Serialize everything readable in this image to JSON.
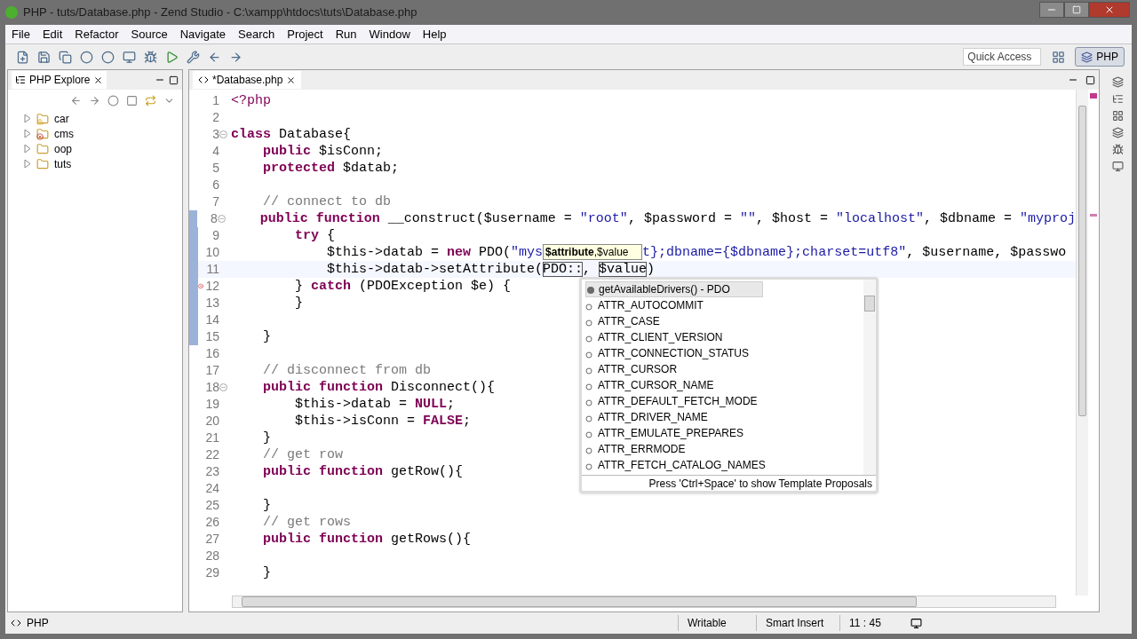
{
  "window": {
    "title": "PHP - tuts/Database.php - Zend Studio - C:\\xampp\\htdocs\\tuts\\Database.php"
  },
  "menu": [
    "File",
    "Edit",
    "Refactor",
    "Source",
    "Navigate",
    "Search",
    "Project",
    "Run",
    "Window",
    "Help"
  ],
  "quick_access": {
    "placeholder": "Quick Access"
  },
  "perspective": {
    "label": "PHP",
    "selected": true
  },
  "explorer": {
    "title": "PHP Explore",
    "items": [
      {
        "name": "car",
        "expanded": false,
        "kind": "warning"
      },
      {
        "name": "cms",
        "expanded": false,
        "kind": "error"
      },
      {
        "name": "oop",
        "expanded": false,
        "kind": "plain"
      },
      {
        "name": "tuts",
        "expanded": false,
        "kind": "plain"
      }
    ]
  },
  "editor": {
    "tab": {
      "label": "*Database.php",
      "selected": true
    },
    "lines": [
      {
        "number": "1",
        "tokens": [
          {
            "kind": "tag",
            "text": "<?php"
          }
        ]
      },
      {
        "number": "2"
      },
      {
        "number": "3",
        "fold": true,
        "tokens": [
          {
            "kind": "keyword",
            "text": "class"
          },
          {
            "kind": "plain",
            "text": " Database{"
          }
        ]
      },
      {
        "number": "4",
        "tokens": [
          {
            "kind": "keyword",
            "text": "    public"
          },
          {
            "kind": "plain",
            "text": " $isConn;"
          }
        ]
      },
      {
        "number": "5",
        "tokens": [
          {
            "kind": "keyword",
            "text": "    protected"
          },
          {
            "kind": "plain",
            "text": " $datab;"
          }
        ]
      },
      {
        "number": "6"
      },
      {
        "number": "7",
        "tokens": [
          {
            "kind": "comment",
            "text": "    // connect to db"
          }
        ]
      },
      {
        "number": "8",
        "fold": true,
        "changed": true,
        "tokens": [
          {
            "kind": "keyword",
            "text": "    public"
          },
          {
            "kind": "keyword",
            "text": " function"
          },
          {
            "kind": "plain",
            "text": " __construct($username = "
          },
          {
            "kind": "string",
            "text": "\"root\""
          },
          {
            "kind": "plain",
            "text": ", $password = "
          },
          {
            "kind": "string",
            "text": "\"\""
          },
          {
            "kind": "plain",
            "text": ", $host = "
          },
          {
            "kind": "string",
            "text": "\"localhost\""
          },
          {
            "kind": "plain",
            "text": ", $dbname = "
          },
          {
            "kind": "string",
            "text": "\"myproj"
          }
        ]
      },
      {
        "number": "9",
        "changed": true,
        "tokens": [
          {
            "kind": "keyword",
            "text": "        try"
          },
          {
            "kind": "plain",
            "text": " {"
          }
        ]
      },
      {
        "number": "10",
        "changed": true,
        "tokens": [
          {
            "kind": "plain",
            "text": "            $this->datab = "
          },
          {
            "kind": "keyword",
            "text": "new"
          },
          {
            "kind": "plain",
            "text": " PDO("
          },
          {
            "kind": "string",
            "text": "\"mys"
          },
          {
            "kind": "hint",
            "text": "**$attribute**,$value"
          },
          {
            "kind": "string",
            "text": "t};dbname={$dbname};charset=utf8\""
          },
          {
            "kind": "plain",
            "text": ", $username, $passwo"
          }
        ]
      },
      {
        "number": "11",
        "changed": true,
        "current": true,
        "tokens": [
          {
            "kind": "plain",
            "text": "            $this->datab->setAttribute("
          },
          {
            "kind": "linked",
            "text": "PDO::"
          },
          {
            "kind": "plain",
            "text": ", "
          },
          {
            "kind": "linked",
            "text": "$value"
          },
          {
            "kind": "plain",
            "text": ")"
          }
        ]
      },
      {
        "number": "12",
        "changed": true,
        "error": true,
        "tokens": [
          {
            "kind": "plain",
            "text": "        } "
          },
          {
            "kind": "keyword",
            "text": "catch"
          },
          {
            "kind": "plain",
            "text": " (PDOException $e) {"
          }
        ]
      },
      {
        "number": "13",
        "changed": true,
        "tokens": [
          {
            "kind": "plain",
            "text": "        }"
          }
        ]
      },
      {
        "number": "14",
        "changed": true
      },
      {
        "number": "15",
        "changed": true,
        "tokens": [
          {
            "kind": "plain",
            "text": "    }"
          }
        ]
      },
      {
        "number": "16"
      },
      {
        "number": "17",
        "tokens": [
          {
            "kind": "comment",
            "text": "    // disconnect from db"
          }
        ]
      },
      {
        "number": "18",
        "fold": true,
        "tokens": [
          {
            "kind": "keyword",
            "text": "    public"
          },
          {
            "kind": "keyword",
            "text": " function"
          },
          {
            "kind": "plain",
            "text": " Disconnect(){"
          }
        ]
      },
      {
        "number": "19",
        "tokens": [
          {
            "kind": "plain",
            "text": "        $this->datab = "
          },
          {
            "kind": "keyword",
            "text": "NULL"
          },
          {
            "kind": "plain",
            "text": ";"
          }
        ]
      },
      {
        "number": "20",
        "tokens": [
          {
            "kind": "plain",
            "text": "        $this->isConn = "
          },
          {
            "kind": "keyword",
            "text": "FALSE"
          },
          {
            "kind": "plain",
            "text": ";"
          }
        ]
      },
      {
        "number": "21",
        "tokens": [
          {
            "kind": "plain",
            "text": "    }"
          }
        ]
      },
      {
        "number": "22",
        "tokens": [
          {
            "kind": "comment",
            "text": "    // get row"
          }
        ]
      },
      {
        "number": "23",
        "tokens": [
          {
            "kind": "keyword",
            "text": "    public"
          },
          {
            "kind": "keyword",
            "text": " function"
          },
          {
            "kind": "plain",
            "text": " getRow(){"
          }
        ]
      },
      {
        "number": "24"
      },
      {
        "number": "25",
        "tokens": [
          {
            "kind": "plain",
            "text": "    }"
          }
        ]
      },
      {
        "number": "26",
        "tokens": [
          {
            "kind": "comment",
            "text": "    // get rows"
          }
        ]
      },
      {
        "number": "27",
        "tokens": [
          {
            "kind": "keyword",
            "text": "    public"
          },
          {
            "kind": "keyword",
            "text": " function"
          },
          {
            "kind": "plain",
            "text": " getRows(){"
          }
        ]
      },
      {
        "number": "28"
      },
      {
        "number": "29",
        "tokens": [
          {
            "kind": "plain",
            "text": "    }"
          }
        ]
      }
    ]
  },
  "completion": {
    "items": [
      {
        "kind": "method",
        "label": "getAvailableDrivers() - PDO",
        "selected": true
      },
      {
        "kind": "constant",
        "label": "ATTR_AUTOCOMMIT",
        "selected": false
      },
      {
        "kind": "constant",
        "label": "ATTR_CASE",
        "selected": false
      },
      {
        "kind": "constant",
        "label": "ATTR_CLIENT_VERSION",
        "selected": false
      },
      {
        "kind": "constant",
        "label": "ATTR_CONNECTION_STATUS",
        "selected": false
      },
      {
        "kind": "constant",
        "label": "ATTR_CURSOR",
        "selected": false
      },
      {
        "kind": "constant",
        "label": "ATTR_CURSOR_NAME",
        "selected": false
      },
      {
        "kind": "constant",
        "label": "ATTR_DEFAULT_FETCH_MODE",
        "selected": false
      },
      {
        "kind": "constant",
        "label": "ATTR_DRIVER_NAME",
        "selected": false
      },
      {
        "kind": "constant",
        "label": "ATTR_EMULATE_PREPARES",
        "selected": false
      },
      {
        "kind": "constant",
        "label": "ATTR_ERRMODE",
        "selected": false
      },
      {
        "kind": "constant",
        "label": "ATTR_FETCH_CATALOG_NAMES",
        "selected": false
      }
    ],
    "footer": "Press 'Ctrl+Space' to show Template Proposals"
  },
  "status_bar": {
    "perspective": "PHP",
    "mode": "Writable",
    "insert": "Smart Insert",
    "position": "11 : 45"
  }
}
